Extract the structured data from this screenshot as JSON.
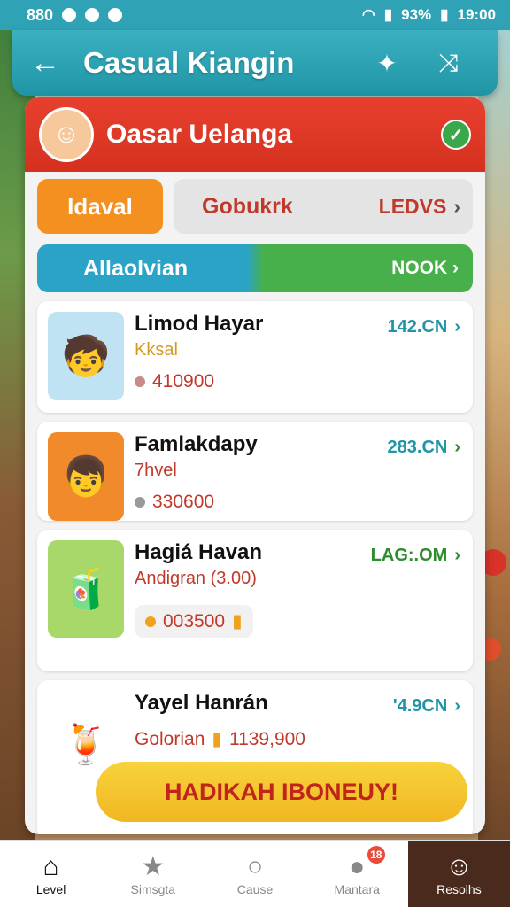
{
  "status_bar": {
    "left_text": "880",
    "battery": "93%",
    "time": "19:00"
  },
  "header": {
    "title": "Casual Kiangin",
    "back_icon": "arrow-left-icon",
    "actions": [
      "share-icon",
      "shuffle-icon"
    ]
  },
  "profile": {
    "name": "Oasar Uelanga",
    "verified": true
  },
  "tabs": {
    "active": "Idaval",
    "other": "Gobukrk",
    "other_right": "LEDVS"
  },
  "banner": {
    "left": "Allaolvian",
    "right": "NOOK"
  },
  "items": [
    {
      "name": "Limod Hayar",
      "sub": "Kksal",
      "price": "410900",
      "code": "142.CN",
      "code_color": "#1f95a6",
      "thumb_icon": "boy-icon",
      "thumb_bg": "#bfe3f2",
      "sub_color": "#d39b21",
      "price_color": "#c0392b"
    },
    {
      "name": "Famlakdapy",
      "sub": "7hvel",
      "price": "330600",
      "code": "283.CN",
      "code_color": "#1f95a6",
      "thumb_icon": "child-icon",
      "thumb_bg": "#f08a2a",
      "sub_color": "#c0392b",
      "price_color": "#c0392b"
    },
    {
      "name": "Hagiá Havan",
      "sub": "Andigran (3.00)",
      "price": "003500",
      "code": "LAG:.OM",
      "code_color": "#2e8b2e",
      "thumb_icon": "boy-juice-icon",
      "thumb_bg": "#a8d86a",
      "sub_color": "#c0392b",
      "price_color": "#c0392b"
    },
    {
      "name": "Yayel Hanrán",
      "sub": "Golorian",
      "price": "1139,900",
      "code": "'4.9CN",
      "code_color": "#1f95a6",
      "thumb_icon": "juice-icon",
      "thumb_bg": "#ffffff",
      "sub_color": "#c0392b",
      "price_color": "#c0392b"
    }
  ],
  "promo": "HADIKAH IBONEUY!",
  "nav": [
    {
      "label": "Level",
      "icon": "home-icon"
    },
    {
      "label": "Simsgta",
      "icon": "star-icon"
    },
    {
      "label": "Cause",
      "icon": "search-icon"
    },
    {
      "label": "Mantara",
      "icon": "profile-icon",
      "badge": "18"
    },
    {
      "label": "Resolhs",
      "icon": "user-edit-icon"
    }
  ]
}
